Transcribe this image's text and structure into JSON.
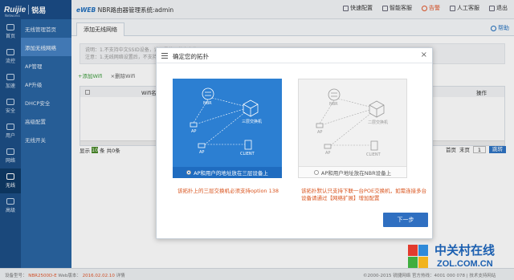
{
  "topbar": {
    "brand": "Ruijie",
    "brand_cn": "锐易",
    "brand_sub": "Networks",
    "app_prefix": "eWEB",
    "app_title": "NBR路由器管理系统:admin",
    "nav": [
      {
        "label": "快速配置"
      },
      {
        "label": "智能客服"
      },
      {
        "label": "告警"
      },
      {
        "label": "人工客服"
      },
      {
        "label": "退出"
      }
    ]
  },
  "icon_sidebar": [
    {
      "label": "首页",
      "icon": "home-icon"
    },
    {
      "label": "流控",
      "icon": "flow-icon"
    },
    {
      "label": "加速",
      "icon": "speed-icon"
    },
    {
      "label": "安全",
      "icon": "shield-icon"
    },
    {
      "label": "用户",
      "icon": "user-icon"
    },
    {
      "label": "网络",
      "icon": "network-icon"
    },
    {
      "label": "无线",
      "icon": "wireless-icon"
    },
    {
      "label": "高级",
      "icon": "advanced-icon"
    }
  ],
  "sub_sidebar": [
    {
      "label": "无线管理首页"
    },
    {
      "label": "添加无线网络"
    },
    {
      "label": "AP管理"
    },
    {
      "label": "AP升级"
    },
    {
      "label": "DHCP安全"
    },
    {
      "label": "高级配置"
    },
    {
      "label": "无线开关"
    }
  ],
  "main": {
    "tab": "添加无线网络",
    "help": "帮助",
    "notice_line1": "说明：1.不支持中文SSID设备，请尽量使用英文名称",
    "notice_line2": "注意：1.无线网络设置后，不支持的终端可能无法连接",
    "add_wifi": "+添加Wifi",
    "del_wifi": "×删除Wifi",
    "table_col_name": "Wifi名",
    "table_col_op": "操作",
    "footer_show": "显示",
    "footer_page_size": "10",
    "footer_total": "条 共0条",
    "pager_first": "首页",
    "pager_last": "末页",
    "pager_input": "1",
    "pager_go": "跳转"
  },
  "dialog": {
    "title": "确定您的拓扑",
    "close": "×",
    "left": {
      "nbr": "NBR",
      "switch": "三层交换机",
      "ap1": "AP",
      "ap2": "AP",
      "client": "CLIENT",
      "option": "AP和用户的地址放在三层设备上"
    },
    "right": {
      "nbr": "NBR",
      "switch": "二层交换机",
      "ap1": "AP",
      "ap2": "AP",
      "client": "CLIENT",
      "option": "AP和用户地址放在NBR设备上"
    },
    "note_left": "该拓扑上的三层交换机必须支持option 138",
    "note_right": "该拓扑默认只支持下联一台POE交换机，如需连接多台设备请通过【网络扩展】增加配置",
    "next": "下一步"
  },
  "statusbar": {
    "model_label": "设备型号：",
    "model": "NBR2500D-E",
    "version_label": "Web版本：",
    "version": "2016.02.02.10",
    "detail": "详情",
    "right": "©2000-2015 锐捷网络    官方热线：4001 000 078  |  技术支持网站"
  },
  "watermark": {
    "cn": "中关村在线",
    "en": "ZOL.COM.CN"
  }
}
